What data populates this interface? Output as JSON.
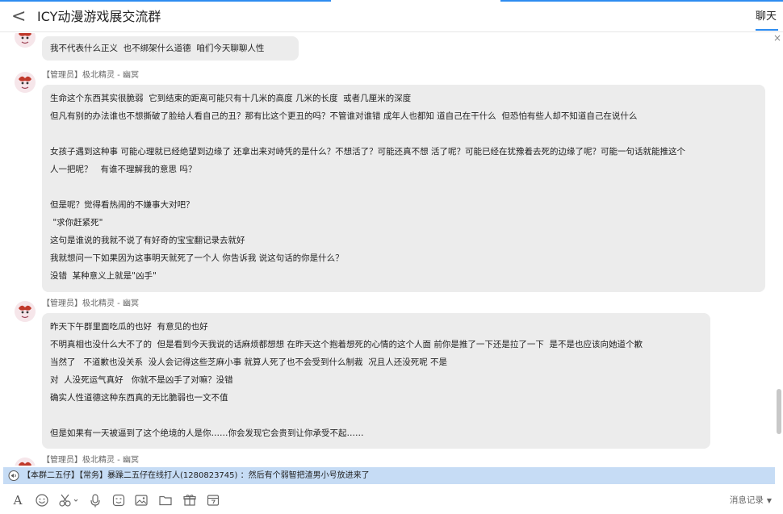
{
  "header": {
    "back_label": "<",
    "title": "ICY动漫游戏展交流群",
    "tab_label": "聊天",
    "close_label": "×"
  },
  "messages": [
    {
      "sender": "",
      "lines": [
        "我不代表什么正义  也不绑架什么道德  咱们今天聊聊人性"
      ]
    },
    {
      "sender": "【管理员】极北精灵 - 幽冥",
      "lines": [
        "生命这个东西其实很脆弱  它到结束的距离可能只有十几米的高度 几米的长度  或者几厘米的深度",
        "但凡有别的办法谁也不想撕破了脸给人看自己的丑？那有比这个更丑的吗？不管谁对谁错 成年人也都知 道自己在干什么  但恐怕有些人却不知道自己在说什么",
        "",
        "女孩子遇到这种事 可能心理就已经绝望到边缘了 还拿出来对峙凭的是什么？不想活了？可能还真不想 活了呢？可能已经在犹豫着去死的边缘了呢？可能一句话就能推这个",
        "人一把呢？   有谁不理解我的意思 吗？",
        "",
        "但是呢？觉得看热闹的不嫌事大对吧？",
        " \"求你赶紧死\"",
        "这句是谁说的我就不说了有好奇的宝宝翻记录去就好",
        "我就想问一下如果因为这事明天就死了一个人 你告诉我 说这句话的你是什么？",
        "没错  某种意义上就是\"凶手\""
      ]
    },
    {
      "sender": "【管理员】极北精灵 - 幽冥",
      "lines": [
        "昨天下午群里面吃瓜的也好  有意见的也好",
        "不明真相也没什么大不了的  但是看到今天我说的话麻烦都想想 在昨天这个抱着想死的心情的这个人面 前你是推了一下还是拉了一下  是不是也应该向她道个歉",
        "当然了   不道歉也没关系  没人会记得这些芝麻小事 就算人死了也不会受到什么制裁  况且人还没死呢 不是",
        "对  人没死运气真好   你就不是凶手了对嘛？没错",
        "确实人性道德这种东西真的无比脆弱也一文不值",
        "",
        "但是如果有一天被逼到了这个绝境的人是你……你会发现它会贵到让你承受不起……"
      ]
    },
    {
      "sender": "【管理员】极北精灵 - 幽冥",
      "lines": []
    }
  ],
  "notice": {
    "text": "【本群二五仔】【常务】暴躁二五仔在线打人(1280823745) ：然后有个弱智把渣男小号放进来了"
  },
  "toolbar": {
    "font_label": "A",
    "history_label": "消息记录",
    "history_caret": "▼"
  },
  "colors": {
    "accent": "#2d8cf0",
    "bubble": "#ececec",
    "notice_bg": "#c6dcf5"
  }
}
